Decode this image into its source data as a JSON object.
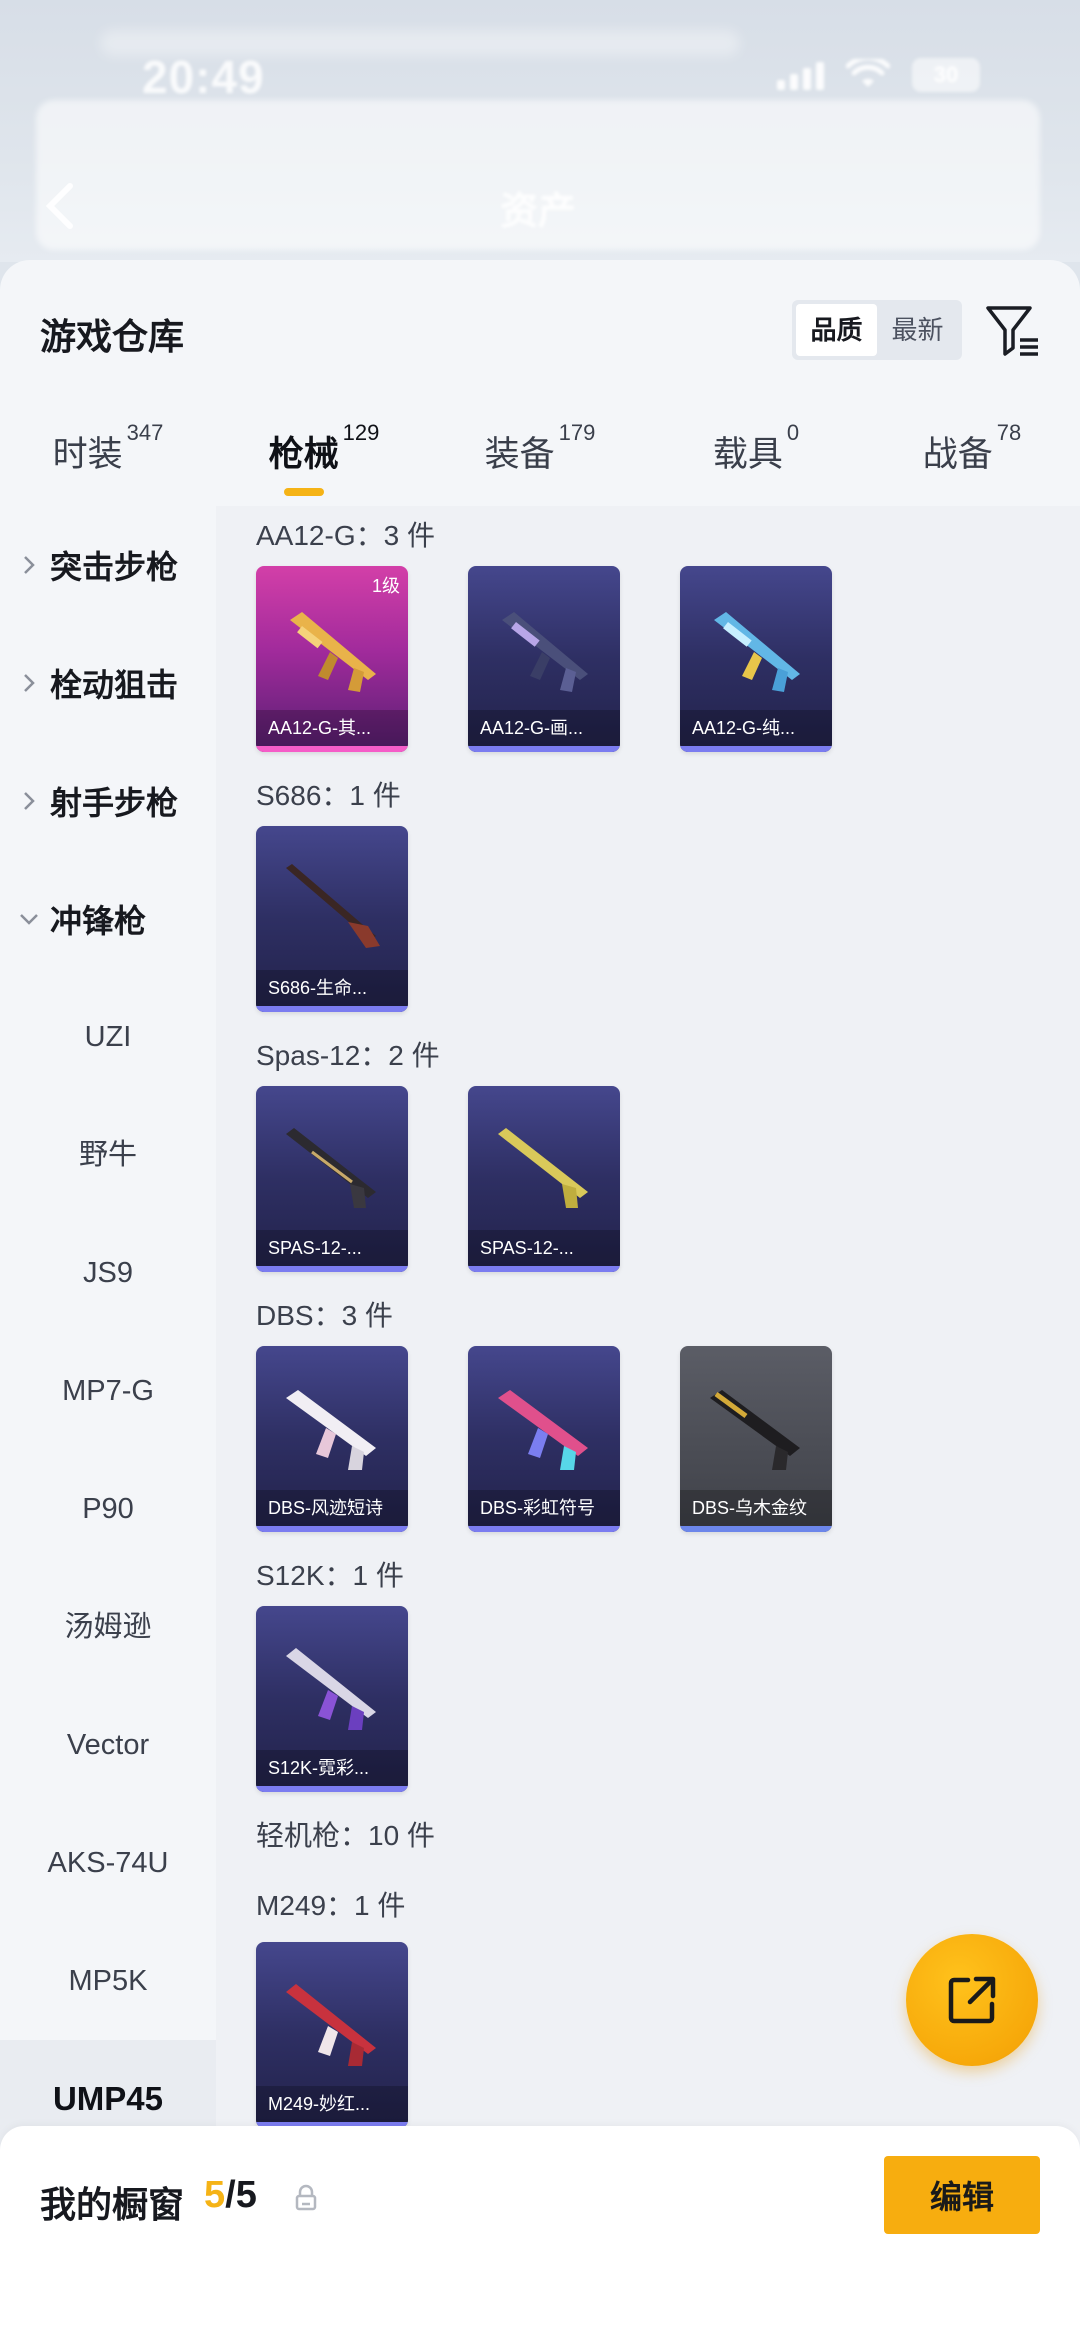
{
  "status": {
    "time": "20:49",
    "battery": "30"
  },
  "header": {
    "title": "资产"
  },
  "sheet": {
    "title": "游戏仓库",
    "sort": {
      "quality": "品质",
      "newest": "最新"
    }
  },
  "tabs": [
    {
      "label": "时装",
      "count": "347"
    },
    {
      "label": "枪械",
      "count": "129"
    },
    {
      "label": "装备",
      "count": "179"
    },
    {
      "label": "载具",
      "count": "0"
    },
    {
      "label": "战备",
      "count": "78"
    }
  ],
  "sidebar": {
    "groups": [
      "突击步枪",
      "栓动狙击",
      "射手步枪",
      "冲锋枪"
    ],
    "items": [
      "UZI",
      "野牛",
      "JS9",
      "MP7-G",
      "P90",
      "汤姆逊",
      "Vector",
      "AKS-74U",
      "MP5K",
      "UMP45"
    ]
  },
  "content": {
    "groups": [
      {
        "label": "AA12-G：3 件"
      },
      {
        "label": "S686：1 件"
      },
      {
        "label": "Spas-12：2 件"
      },
      {
        "label": "DBS：3 件"
      },
      {
        "label": "S12K：1 件"
      },
      {
        "label": "轻机枪：10 件"
      },
      {
        "label": "M249：1 件"
      }
    ],
    "items": [
      {
        "name": "AA12-G-其...",
        "level": "1级"
      },
      {
        "name": "AA12-G-画..."
      },
      {
        "name": "AA12-G-纯..."
      },
      {
        "name": "S686-生命..."
      },
      {
        "name": "SPAS-12-..."
      },
      {
        "name": "SPAS-12-..."
      },
      {
        "name": "DBS-风迹短诗"
      },
      {
        "name": "DBS-彩虹符号"
      },
      {
        "name": "DBS-乌木金纹"
      },
      {
        "name": "S12K-霓彩..."
      },
      {
        "name": "M249-妙红..."
      }
    ]
  },
  "showcase": {
    "label": "我的橱窗",
    "used": "5",
    "sep": "/",
    "total": "5",
    "edit": "编辑"
  },
  "colors": {
    "accent": "#f5b316",
    "card_purple": "#2e2f63",
    "card_pink": "#a22b9c",
    "card_gray": "#4b4d55"
  }
}
